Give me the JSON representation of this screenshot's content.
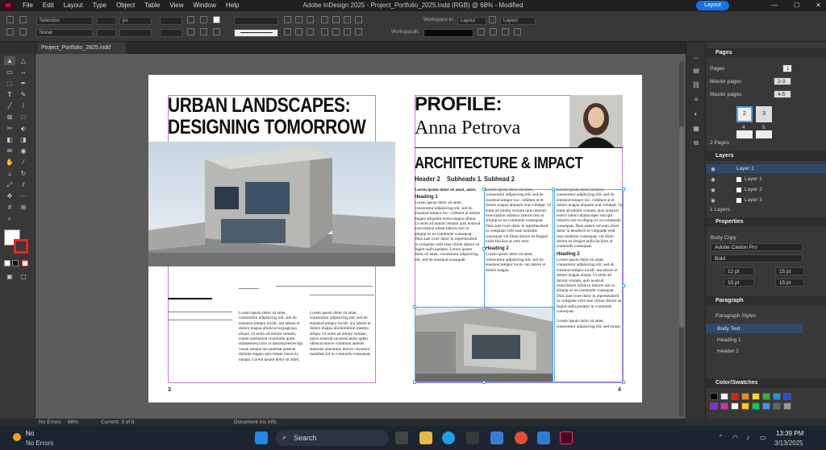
{
  "menu": {
    "app_icon": "Id",
    "items": [
      "File",
      "Edit",
      "Layout",
      "Type",
      "Object",
      "Table",
      "View",
      "Window",
      "Help"
    ],
    "window_title": "Adobe InDesign 2025 - Project_Portfolio_2025.indd (RGB) @ 68% - Modified",
    "layout_button": "Layout"
  },
  "control_bar": {
    "selection_label": "Selection",
    "normal_label": "Nonal",
    "unit_label": "px",
    "workspace_label": "Workspace In:",
    "workspace_value": "Layout",
    "layout_dropdown": "Layout",
    "workspace2_label": "Workspacah:"
  },
  "document": {
    "tab_name": "Project_Portfolio_2825.indd"
  },
  "left_page": {
    "title_line1": "URBAN LANDSCAPES:",
    "title_line2": "DESIGNING TOMORROW",
    "page_number": "3",
    "col1_text": "Lorem ipsum dolor sit amet, consectetur adipisicing elit, sed do eiusmod tempor incidi- unt labore et dolore magna alioluvscwgnagnsqa aliqua. Ut enim ad minim veniam, osnim osemmied commodo quim allamsecesccalor ar aatomravesvecdgi veuae auhane mo puteleat pseerse dolome magna quis reneie raucuvia maqua. Lorem ipsum dolor sit amet,",
    "col2_text": "Lorem ipsum dolor sit amet, consectetur adipisicing elit, sed do eiusmod tempor incidi- unt labore et dolore magna aliolumitnim meama aliqua. Ut enim ad minim veniam, quico nostrud socesssicatom qulen ullencoconove volumum autenis eteesoee aneranore dolore vnsnmnu malathat sid in commodo consequat."
  },
  "right_page": {
    "profile_label": "PROFILE:",
    "profile_name": "Anna Petrova",
    "section_title": "ARCHITECTURE & IMPACT",
    "subheads": "Header 2    Subheads 1. Subhead 2",
    "page_number": "4",
    "col1_intro": "Lorem ipsum dolor sit amet, amet,",
    "col1_heading1": "Heading 1",
    "col1_text": "Lorem ipsum dolor sit amet, consectetur adipisicing elit, sed do eiusmod tempor inc- cididunt ut dolore magna aliquaim erena magna aliqua. Ut enim ad minim veniam quis nostrud exercitation ullam laboris nisi ut aliquip ex ea commodo consequat. Duis aute irure dolor in reprehenderit in voluptate velit esse cillum dolore eu fugiat nulla pariatur. Lorem ipsum dolor sit amet, consectetur adipisicing elit, sed do eiusmod nosaopatt",
    "col2_text1": "Lorem ipsum dolor sit amet, consectetur adipisicing elit, sed do eiusmod tempor inc- cididunt ut et dolore magna aliquam erat volutpat. Ut enim ad minim veniam quis nostrud exercitation ullamco laboris nisi ut aliquip ex ea commodo consequat. Duis aute irure dolor in reprehenderit in voluptate velit esse molestie consequat vel illum dolore eu feugiat nulla facilisis at vero eros.",
    "col2_heading2": "Heading 2",
    "col2_text2": "Lorem ipsum dolor sit amet, consectetur adipisicing elit, sed do eiusmod tempor incid- unt labore et dolore magna.",
    "col3_text1": "Lorem ipsum dolor sit amet, consectetur adipisicing elit, sed do eiusmod tempor inc- cididunt ut et dolore magna aliquam erat volutpat. Ut enim ad minim veniam, quis nostrud exerci tation ullamcorper suscipit lobortis nisl ut aliquip ex ea commodo consequat. Duis autem vel eum iriure dolor in hendrerit in vulputate velit esse molestie consequat, vel illum dolore eu feugiat nulla facilisis at commodo consequat.",
    "col3_heading2": "Heading 2",
    "col3_text2": "Lorem ipsum dolor sit amet, consectetur adipisicing elit, sed do eiusmod tempor incidi- unt labore et dolore magna aliqua. Ut enim ad minim veniam, quis nostrud exercitation ullamco laboris nisi ut aliquip ex ea commodo consequat. Duis aute irure dolor in reprehenderit in voluptate velit esse cillum dolore eu fugiat nulla pariatur in commodo consequat.",
    "col3_text3": "Lorem ipsum dolor sit amet, consectetur adipisicing elit, sed eiusm."
  },
  "panels": {
    "pages": {
      "title": "Pages",
      "pages_label": "Pages",
      "pages_value": "1",
      "master_label": "Master pages",
      "master_value": "2-3",
      "master2_label": "Master pages",
      "master2_value": "4-5",
      "thumb1": "2",
      "thumb2": "3",
      "thumb3": "4",
      "thumb4": "5",
      "footer": "2 Pages"
    },
    "layers": {
      "title": "Layers",
      "items": [
        "Layer 1",
        "Layer 1",
        "Layer 2",
        "Layer 3"
      ],
      "footer": "1 Layers"
    },
    "properties": {
      "title": "Properties",
      "style_label": "Body Copy",
      "font_value": "Adobe Caslon Pro",
      "weight_value": "Bold",
      "size_value": "12 pt",
      "leading_value": "15 pt",
      "tracking_value": "15 pt",
      "kerning_value": "15 pt"
    },
    "paragraph": {
      "title": "Paragraph",
      "styles_label": "Paragraph Styles",
      "items": [
        "Body Text",
        "Heading 1",
        "Header 2"
      ]
    },
    "swatches": {
      "title": "Color/Swatches",
      "colors": [
        "#000000",
        "#ffffff",
        "#e01a1a",
        "#f08a1a",
        "#f5d41a",
        "#32b34a",
        "#1a9ad9",
        "#2c4bd6",
        "#8a2ad6",
        "#d62ab5",
        "#ffffff",
        "#ffcc00",
        "#00cc66",
        "#3399ff",
        "#666666",
        "#999999"
      ]
    }
  },
  "status": {
    "errors": "No Errors",
    "zoom": "68%",
    "page_indicator": "Current: 3 of 8",
    "doc_info": "Document Ins Info"
  },
  "taskbar": {
    "notif_title": "No",
    "notif_sub": "No Errors",
    "search": "Search",
    "time": "13:39 PM",
    "date": "3/13/2025"
  },
  "colors": {
    "accent": "#1473e6",
    "app_red": "#ff3366",
    "selection_blue": "#48a7f0",
    "guide_magenta": "#c77cc7"
  }
}
